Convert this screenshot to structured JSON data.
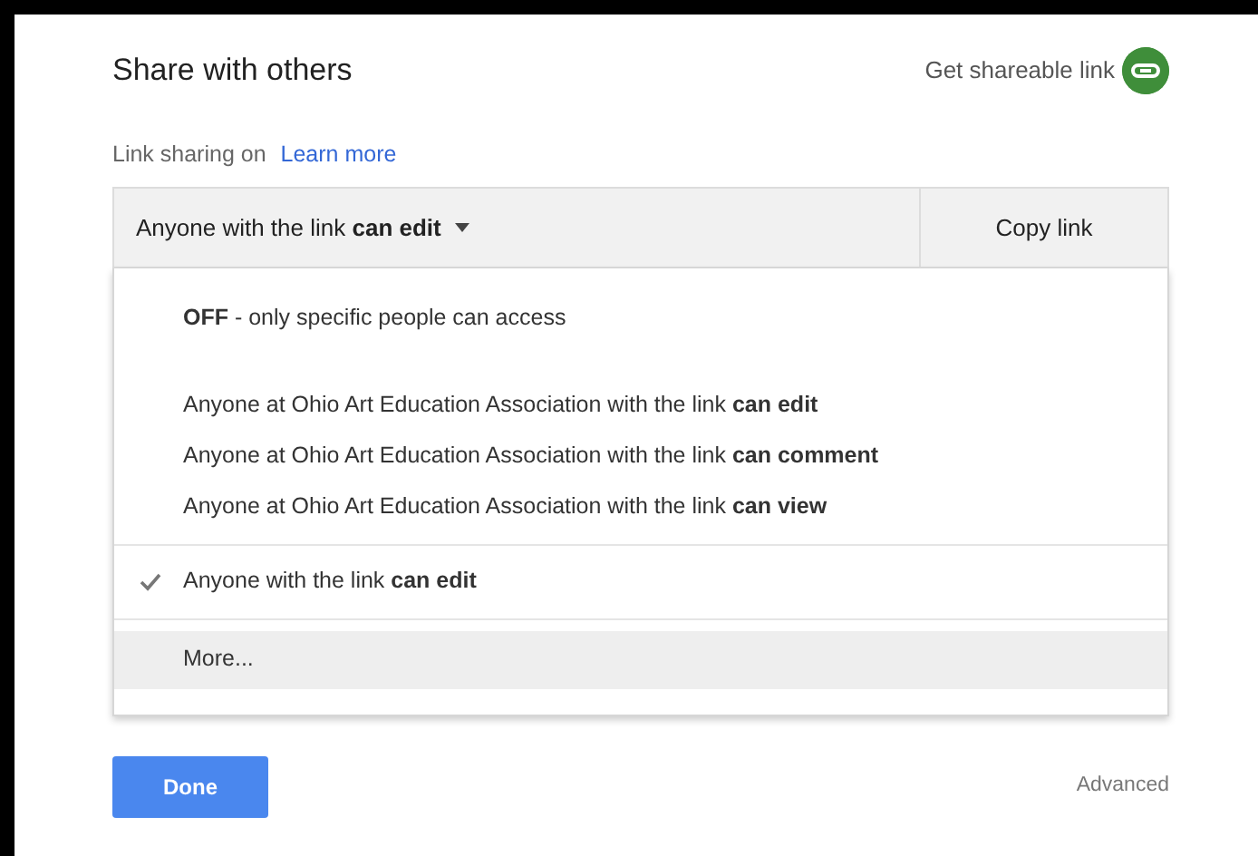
{
  "dialog": {
    "title": "Share with others",
    "shareable_link": "Get shareable link"
  },
  "link_sharing": {
    "status": "Link sharing on",
    "learn_more": "Learn more"
  },
  "access_dropdown": {
    "value": "Anyone with the link **can edit**",
    "expanded": true,
    "copy_button": "Copy link"
  },
  "menu_groups": [
    {
      "divider_above": false,
      "items": [
        {
          "text": "**OFF** - only specific people can access",
          "selected": false,
          "highlighted": false
        }
      ]
    },
    {
      "divider_above": false,
      "items": [
        {
          "text": "Anyone at Ohio Art Education Association with the link **can edit**",
          "selected": false,
          "highlighted": false
        },
        {
          "text": "Anyone at Ohio Art Education Association with the link **can comment**",
          "selected": false,
          "highlighted": false
        },
        {
          "text": "Anyone at Ohio Art Education Association with the link **can view**",
          "selected": false,
          "highlighted": false
        }
      ]
    },
    {
      "divider_above": true,
      "items": [
        {
          "text": "Anyone with the link **can edit**",
          "selected": true,
          "highlighted": false
        }
      ]
    },
    {
      "divider_above": true,
      "items": [
        {
          "text": "More...",
          "selected": false,
          "highlighted": true
        }
      ]
    }
  ],
  "footer": {
    "done_button": "Done",
    "advanced": "Advanced"
  }
}
